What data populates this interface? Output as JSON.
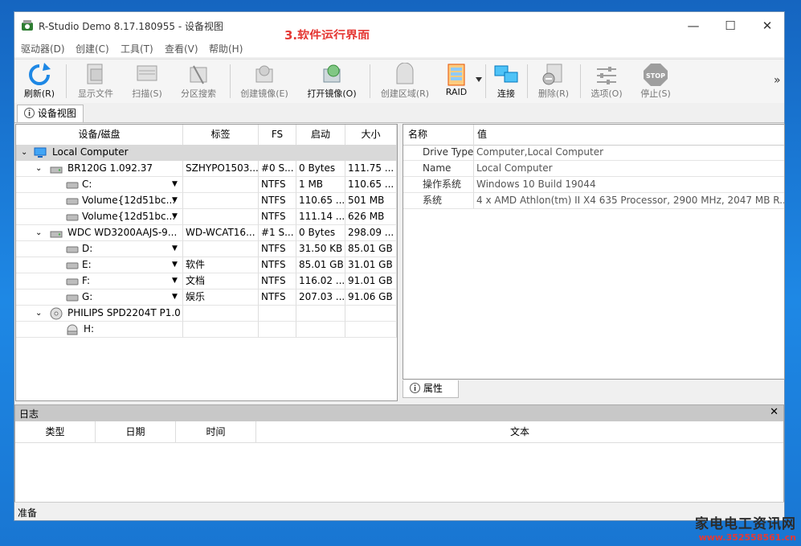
{
  "window": {
    "title": "R-Studio Demo 8.17.180955 - 设备视图",
    "controls": {
      "minimize": "—",
      "maximize": "☐",
      "close": "✕"
    }
  },
  "annotation": "3.软件运行界面",
  "menu": [
    "驱动器(D)",
    "创建(C)",
    "工具(T)",
    "查看(V)",
    "帮助(H)"
  ],
  "toolbar": {
    "refresh": "刷新(R)",
    "show_files": "显示文件",
    "scan": "扫描(S)",
    "partition_search": "分区搜索",
    "create_image": "创建镜像(E)",
    "open_image": "打开镜像(O)",
    "create_region": "创建区域(R)",
    "raid": "RAID",
    "connect": "连接",
    "delete": "删除(R)",
    "options": "选项(O)",
    "stop": "停止(S)",
    "stop_icon_text": "STOP",
    "more": "»"
  },
  "tab": {
    "device_view": "设备视图"
  },
  "device_grid": {
    "headers": [
      "设备/磁盘",
      "标签",
      "FS",
      "启动",
      "大小"
    ],
    "rows": [
      {
        "name": "Local Computer",
        "label": "",
        "fs": "",
        "start": "",
        "size": ""
      },
      {
        "name": "BR120G 1.092.37",
        "label": "SZHYPO1503...",
        "fs": "#0 S...",
        "start": "0 Bytes",
        "size": "111.75 ..."
      },
      {
        "name": "C:",
        "label": "",
        "fs": "NTFS",
        "start": "1 MB",
        "size": "110.65 ..."
      },
      {
        "name": "Volume{12d51bc...",
        "label": "",
        "fs": "NTFS",
        "start": "110.65 ...",
        "size": "501 MB"
      },
      {
        "name": "Volume{12d51bc...",
        "label": "",
        "fs": "NTFS",
        "start": "111.14 ...",
        "size": "626 MB"
      },
      {
        "name": "WDC WD3200AAJS-9...",
        "label": "WD-WCAT16...",
        "fs": "#1 S...",
        "start": "0 Bytes",
        "size": "298.09 ..."
      },
      {
        "name": "D:",
        "label": "",
        "fs": "NTFS",
        "start": "31.50 KB",
        "size": "85.01 GB"
      },
      {
        "name": "E:",
        "label": "软件",
        "fs": "NTFS",
        "start": "85.01 GB",
        "size": "31.01 GB"
      },
      {
        "name": "F:",
        "label": "文档",
        "fs": "NTFS",
        "start": "116.02 ...",
        "size": "91.01 GB"
      },
      {
        "name": "G:",
        "label": "娱乐",
        "fs": "NTFS",
        "start": "207.03 ...",
        "size": "91.06 GB"
      },
      {
        "name": "PHILIPS SPD2204T P1.0",
        "label": "",
        "fs": "",
        "start": "",
        "size": ""
      },
      {
        "name": "H:",
        "label": "",
        "fs": "",
        "start": "",
        "size": ""
      }
    ]
  },
  "properties": {
    "headers": [
      "名称",
      "值"
    ],
    "rows": [
      {
        "name": "Drive Type",
        "value": "Computer,Local Computer"
      },
      {
        "name": "Name",
        "value": "Local Computer"
      },
      {
        "name": "操作系统",
        "value": "Windows 10 Build 19044"
      },
      {
        "name": "系统",
        "value": "4 x AMD Athlon(tm) II X4 635 Processor, 2900 MHz, 2047 MB R..."
      }
    ],
    "tab": "属性"
  },
  "log": {
    "title": "日志",
    "close": "✕",
    "headers": [
      "类型",
      "日期",
      "时间",
      "文本"
    ]
  },
  "status": "准备",
  "watermark": {
    "line1": "家电电工资讯网",
    "line2": "www.352558561.cn"
  },
  "colors": {
    "accent": "#1e88e5",
    "annotation": "#e53935",
    "selected_row": "#d9d9d9"
  }
}
